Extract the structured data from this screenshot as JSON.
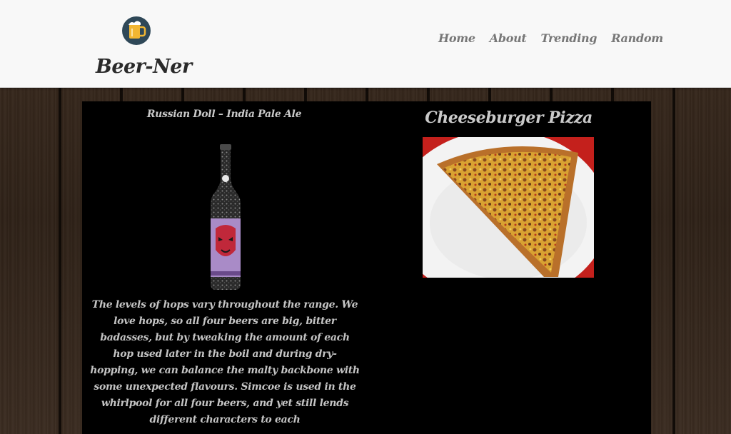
{
  "header": {
    "brand": "Beer-Ner",
    "logo_icon": "beer-mug-icon",
    "nav": [
      {
        "label": "Home"
      },
      {
        "label": "About"
      },
      {
        "label": "Trending"
      },
      {
        "label": "Random"
      }
    ]
  },
  "beer": {
    "name": "Russian Doll – India Pale Ale",
    "image_icon": "beer-bottle-image",
    "description": "The levels of hops vary throughout the range. We love hops, so all four beers are big, bitter badasses, but by tweaking the amount of each hop used later in the boil and during dry- hopping, we can balance the malty backbone with some unexpected flavours. Simcoe is used in the whirlpool for all four beers, and yet still lends different characters to each"
  },
  "food": {
    "name": "Cheeseburger Pizza",
    "image_icon": "pizza-slice-image"
  },
  "colors": {
    "header_bg": "#f8f8f8",
    "panel_bg": "#000000",
    "logo_circle": "#2f4858",
    "beer_yellow": "#f2b632",
    "nav_text": "#777777",
    "panel_text": "#c4c4c4"
  }
}
